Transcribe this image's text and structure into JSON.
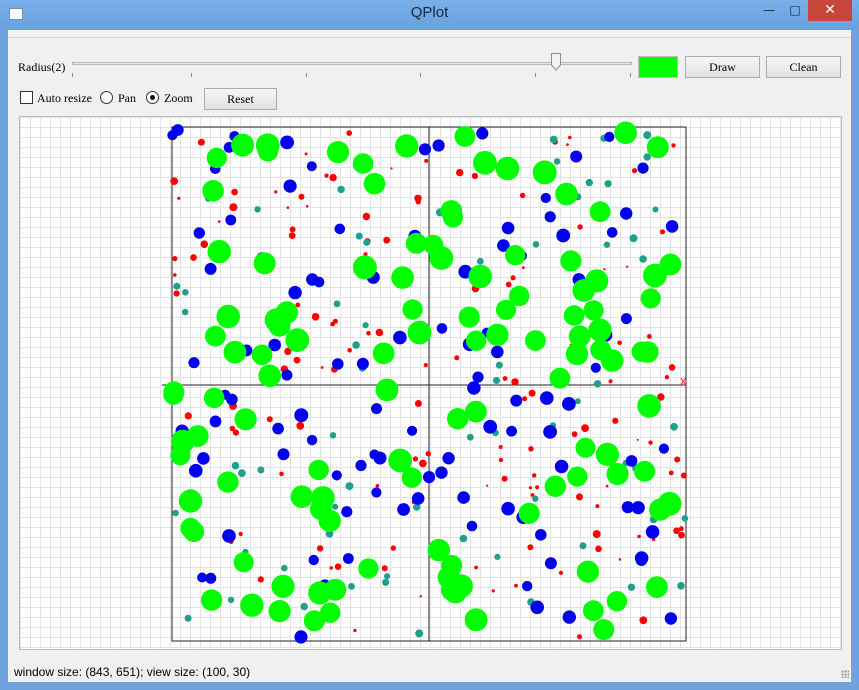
{
  "window": {
    "title": "QPlot",
    "minimize_glyph": "—",
    "maximize_glyph": "□",
    "close_glyph": "✕"
  },
  "controls": {
    "radius_label": "Radius(2)",
    "radius_value": 0.87,
    "draw_label": "Draw",
    "clean_label": "Clean",
    "brush_color": "#00ff00",
    "auto_resize_label": "Auto resize",
    "auto_resize_checked": false,
    "pan_label": "Pan",
    "zoom_label": "Zoom",
    "mode_selected": "Zoom",
    "reset_label": "Reset"
  },
  "plot": {
    "marker": "x"
  },
  "status": {
    "text": "window size: (843, 651); view size: (100, 30)"
  }
}
